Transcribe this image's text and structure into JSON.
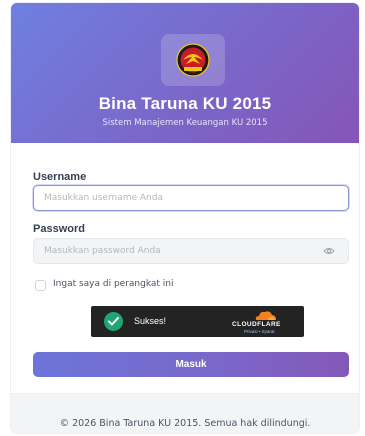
{
  "header": {
    "title": "Bina Taruna KU 2015",
    "subtitle": "Sistem Manajemen Keuangan KU 2015",
    "logo_icon": "club-crest-icon",
    "gradient_start": "#6f7fe0",
    "gradient_end": "#8655b8"
  },
  "form": {
    "username_label": "Username",
    "username_placeholder": "Masukkan username Anda",
    "username_value": "",
    "password_label": "Password",
    "password_placeholder": "Masukkan password Anda",
    "password_value": "",
    "password_toggle_icon": "eye-icon",
    "remember_label": "Ingat saya di perangkat ini",
    "remember_checked": false,
    "submit_label": "Masuk"
  },
  "captcha": {
    "status_text": "Sukses!",
    "provider": "CLOUDFLARE",
    "links_text": "Privasi • Syarat",
    "status_icon": "check-circle-icon",
    "status_color": "#1ea672"
  },
  "footer": {
    "text": "© 2026 Bina Taruna KU 2015. Semua hak dilindungi."
  }
}
